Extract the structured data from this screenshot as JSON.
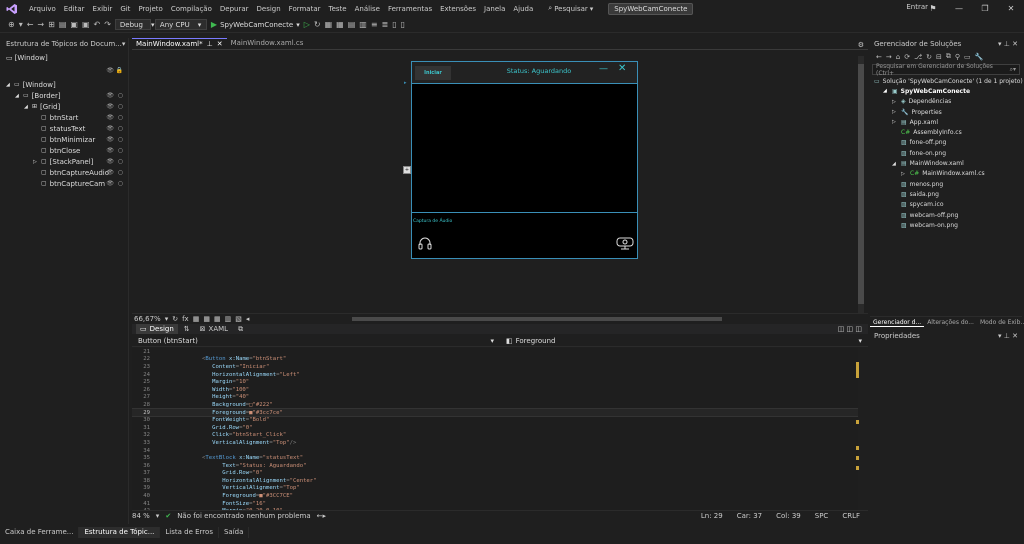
{
  "menubar": {
    "items": [
      "Arquivo",
      "Editar",
      "Exibir",
      "Git",
      "Projeto",
      "Compilação",
      "Depurar",
      "Design",
      "Formatar",
      "Teste",
      "Análise",
      "Ferramentas",
      "Extensões",
      "Janela",
      "Ajuda"
    ],
    "search_label": "Pesquisar",
    "solution_name": "SpyWebCamConecte",
    "signin": "Entrar"
  },
  "toolbar": {
    "config": "Debug",
    "platform": "Any CPU",
    "run_label": "SpyWebCamConecte"
  },
  "left_panel": {
    "title": "Estrutura de Tópicos do Docum...",
    "root_label": "[Window]",
    "tree": [
      {
        "label": "[Window]",
        "indent": 0,
        "toggle": "◢"
      },
      {
        "label": "[Border]",
        "indent": 1,
        "toggle": "◢"
      },
      {
        "label": "[Grid]",
        "indent": 2,
        "toggle": "◢"
      },
      {
        "label": "btnStart",
        "indent": 3,
        "toggle": ""
      },
      {
        "label": "statusText",
        "indent": 3,
        "toggle": ""
      },
      {
        "label": "btnMinimizar",
        "indent": 3,
        "toggle": ""
      },
      {
        "label": "btnClose",
        "indent": 3,
        "toggle": ""
      },
      {
        "label": "[StackPanel]",
        "indent": 3,
        "toggle": "▷"
      },
      {
        "label": "btnCaptureAudio",
        "indent": 3,
        "toggle": ""
      },
      {
        "label": "btnCaptureCam",
        "indent": 3,
        "toggle": ""
      }
    ]
  },
  "doc_tabs": [
    {
      "label": "MainWindow.xaml*",
      "active": true
    },
    {
      "label": "MainWindow.xaml.cs",
      "active": false
    }
  ],
  "design": {
    "btn_start": "Iniciar",
    "status_text": "Status: Aguardando",
    "capture_label": "Captura de Áudio",
    "zoom": "66,67%"
  },
  "view_tabs": {
    "design": "Design",
    "xaml": "XAML"
  },
  "selector": {
    "left": "Button (btnStart)",
    "right": "Foreground"
  },
  "code_lines": [
    {
      "n": "21",
      "html": ""
    },
    {
      "n": "22",
      "html": "<span class='t-punct'>&lt;</span><span class='t-tag'>Button</span> <span class='t-attr'>x:Name</span><span class='t-punct'>=</span><span class='t-str'>\"btnStart\"</span>"
    },
    {
      "n": "23",
      "html": "   <span class='t-attr'>Content</span><span class='t-punct'>=</span><span class='t-str'>\"Iniciar\"</span>"
    },
    {
      "n": "24",
      "html": "   <span class='t-attr'>HorizontalAlignment</span><span class='t-punct'>=</span><span class='t-str'>\"Left\"</span>"
    },
    {
      "n": "25",
      "html": "   <span class='t-attr'>Margin</span><span class='t-punct'>=</span><span class='t-str'>\"10\"</span>"
    },
    {
      "n": "26",
      "html": "   <span class='t-attr'>Width</span><span class='t-punct'>=</span><span class='t-str'>\"100\"</span>"
    },
    {
      "n": "27",
      "html": "   <span class='t-attr'>Height</span><span class='t-punct'>=</span><span class='t-str'>\"40\"</span>"
    },
    {
      "n": "28",
      "html": "   <span class='t-attr'>Background</span><span class='t-punct'>=</span><span class='t-str'>□\"#222\"</span>"
    },
    {
      "n": "29",
      "html": "   <span class='t-attr'>Foreground</span><span class='t-punct'>=</span><span class='t-str'>■\"#3cc7ce\"</span>",
      "cur": true
    },
    {
      "n": "30",
      "html": "   <span class='t-attr'>FontWeight</span><span class='t-punct'>=</span><span class='t-str'>\"Bold\"</span>"
    },
    {
      "n": "31",
      "html": "   <span class='t-attr'>Grid.Row</span><span class='t-punct'>=</span><span class='t-str'>\"0\"</span>"
    },
    {
      "n": "32",
      "html": "   <span class='t-attr'>Click</span><span class='t-punct'>=</span><span class='t-str'>\"btnStart_Click\"</span>"
    },
    {
      "n": "33",
      "html": "   <span class='t-attr'>VerticalAlignment</span><span class='t-punct'>=</span><span class='t-str'>\"Top\"</span><span class='t-punct'>/&gt;</span>"
    },
    {
      "n": "34",
      "html": ""
    },
    {
      "n": "35",
      "html": "<span class='t-punct'>&lt;</span><span class='t-tag'>TextBlock</span> <span class='t-attr'>x:Name</span><span class='t-punct'>=</span><span class='t-str'>\"statusText\"</span>"
    },
    {
      "n": "36",
      "html": "      <span class='t-attr'>Text</span><span class='t-punct'>=</span><span class='t-str'>\"Status: Aguardando\"</span>"
    },
    {
      "n": "37",
      "html": "      <span class='t-attr'>Grid.Row</span><span class='t-punct'>=</span><span class='t-str'>\"0\"</span>"
    },
    {
      "n": "38",
      "html": "      <span class='t-attr'>HorizontalAlignment</span><span class='t-punct'>=</span><span class='t-str'>\"Center\"</span>"
    },
    {
      "n": "39",
      "html": "      <span class='t-attr'>VerticalAlignment</span><span class='t-punct'>=</span><span class='t-str'>\"Top\"</span>"
    },
    {
      "n": "40",
      "html": "      <span class='t-attr'>Foreground</span><span class='t-punct'>=</span><span class='t-str'>■\"#3CC7CE\"</span>"
    },
    {
      "n": "41",
      "html": "      <span class='t-attr'>FontSize</span><span class='t-punct'>=</span><span class='t-str'>\"16\"</span>"
    },
    {
      "n": "42",
      "html": "      <span class='t-attr'>Margin</span><span class='t-punct'>=</span><span class='t-str'>\"0,20,0,10\"</span>"
    }
  ],
  "editor_status": {
    "zoom": "84 %",
    "message": "Não foi encontrado nenhum problema",
    "ln": "Ln: 29",
    "car": "Car: 37",
    "col": "Col: 39",
    "spc": "SPC",
    "crlf": "CRLF"
  },
  "bottom_tabs": [
    "Caixa de Ferrame...",
    "Estrutura de Tópic...",
    "Lista de Erros",
    "Saída"
  ],
  "right_panel": {
    "title": "Gerenciador de Soluções",
    "search_placeholder": "Pesquisar em Gerenciador de Soluções (Ctrl+",
    "items": [
      {
        "label": "Solução 'SpyWebCamConecte' (1 de 1 projeto)",
        "indent": 0,
        "icon": "▭"
      },
      {
        "label": "SpyWebCamConecte",
        "indent": 1,
        "icon": "▣",
        "bold": true,
        "toggle": "◢"
      },
      {
        "label": "Dependências",
        "indent": 2,
        "icon": "◈",
        "toggle": "▷"
      },
      {
        "label": "Properties",
        "indent": 2,
        "icon": "🔧",
        "toggle": "▷"
      },
      {
        "label": "App.xaml",
        "indent": 2,
        "icon": "▤",
        "toggle": "▷"
      },
      {
        "label": "AssemblyInfo.cs",
        "indent": 2,
        "icon": "C#"
      },
      {
        "label": "fone-off.png",
        "indent": 2,
        "icon": "▨"
      },
      {
        "label": "fone-on.png",
        "indent": 2,
        "icon": "▨"
      },
      {
        "label": "MainWindow.xaml",
        "indent": 2,
        "icon": "▤",
        "toggle": "◢"
      },
      {
        "label": "MainWindow.xaml.cs",
        "indent": 3,
        "icon": "C#",
        "toggle": "▷"
      },
      {
        "label": "menos.png",
        "indent": 2,
        "icon": "▨"
      },
      {
        "label": "saida.png",
        "indent": 2,
        "icon": "▨"
      },
      {
        "label": "spycam.ico",
        "indent": 2,
        "icon": "▨"
      },
      {
        "label": "webcam-off.png",
        "indent": 2,
        "icon": "▨"
      },
      {
        "label": "webcam-on.png",
        "indent": 2,
        "icon": "▨"
      }
    ],
    "tabs": [
      "Gerenciador d...",
      "Alterações do...",
      "Modo de Exib..."
    ],
    "properties_title": "Propriedades"
  },
  "colors": {
    "accent": "#3cc7ce",
    "app_bg": "#000000",
    "border": "#3a8fb7"
  }
}
